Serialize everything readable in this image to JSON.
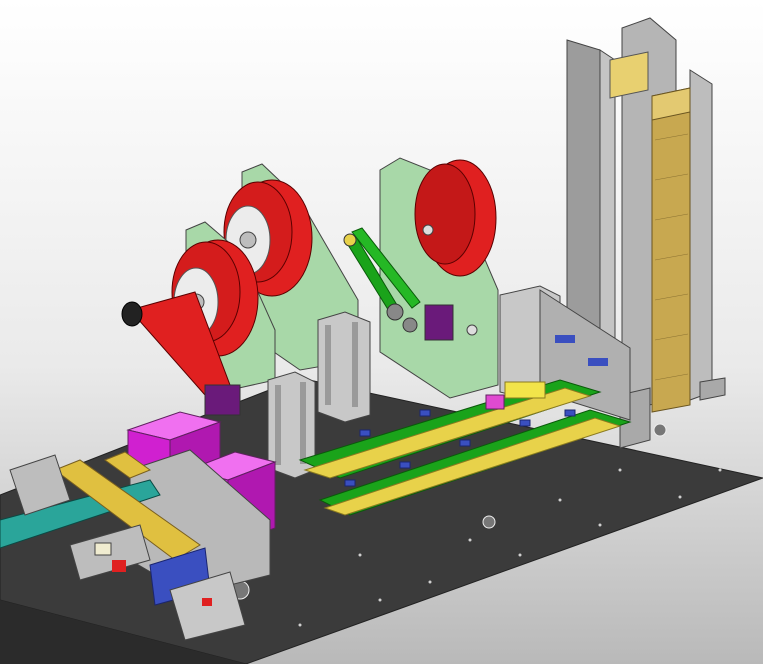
{
  "scene": {
    "description": "",
    "colors": {
      "background_top": "#ffffff",
      "background_bottom": "#b9b9b9",
      "base_plate": "#3b3b3b",
      "side_plate": "#a8d8a8",
      "reel": "#e02020",
      "frame_grey": "#b8b8b8",
      "cover_magenta": "#d020d0",
      "track_green": "#1aa31a",
      "rail_yellow": "#e8d24a",
      "block_blue": "#3a4fc0",
      "cable_teal": "#2aa59a",
      "stack_gold": "#c8a850"
    }
  }
}
